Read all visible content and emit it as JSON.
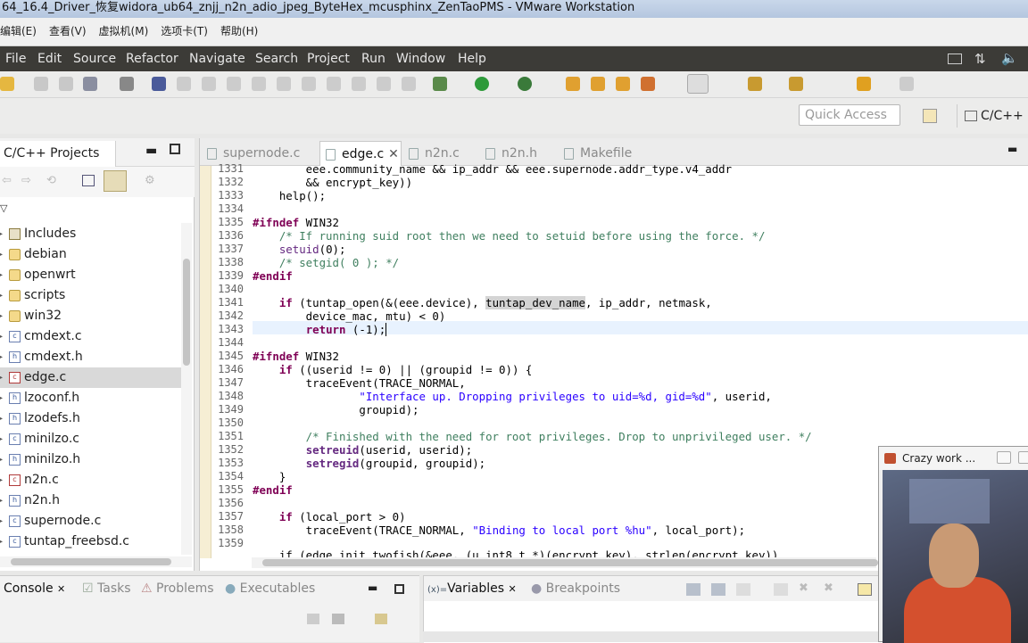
{
  "window": {
    "title": "64_16.4_Driver_恢复widora_ub64_znjj_n2n_adio_jpeg_ByteHex_mcusphinx_ZenTaoPMS - VMware Workstation"
  },
  "vm_menu": [
    "编辑(E)",
    "查看(V)",
    "虚拟机(M)",
    "选项卡(T)",
    "帮助(H)"
  ],
  "menu": [
    "File",
    "Edit",
    "Source",
    "Refactor",
    "Navigate",
    "Search",
    "Project",
    "Run",
    "Window",
    "Help"
  ],
  "quick_access": {
    "placeholder": "Quick Access"
  },
  "perspective": {
    "label": "C/C++"
  },
  "project_explorer": {
    "tab_label": "C/C++ Projects",
    "items": [
      {
        "label": "Includes",
        "icon": "includes-icon"
      },
      {
        "label": "debian",
        "icon": "folder-icon"
      },
      {
        "label": "openwrt",
        "icon": "folder-icon"
      },
      {
        "label": "scripts",
        "icon": "folder-icon"
      },
      {
        "label": "win32",
        "icon": "folder-icon"
      },
      {
        "label": "cmdext.c",
        "icon": "c-file-icon"
      },
      {
        "label": "cmdext.h",
        "icon": "h-file-icon"
      },
      {
        "label": "edge.c",
        "icon": "c-file-error-icon"
      },
      {
        "label": "lzoconf.h",
        "icon": "h-file-icon"
      },
      {
        "label": "lzodefs.h",
        "icon": "h-file-icon"
      },
      {
        "label": "minilzo.c",
        "icon": "c-file-icon"
      },
      {
        "label": "minilzo.h",
        "icon": "h-file-icon"
      },
      {
        "label": "n2n.c",
        "icon": "c-file-error-icon"
      },
      {
        "label": "n2n.h",
        "icon": "h-file-icon"
      },
      {
        "label": "supernode.c",
        "icon": "c-file-icon"
      },
      {
        "label": "tuntap_freebsd.c",
        "icon": "c-file-icon"
      }
    ]
  },
  "editor": {
    "tabs": [
      {
        "label": "supernode.c",
        "active": false
      },
      {
        "label": "edge.c",
        "active": true
      },
      {
        "label": "n2n.c",
        "active": false
      },
      {
        "label": "n2n.h",
        "active": false
      },
      {
        "label": "Makefile",
        "active": false
      }
    ],
    "line_numbers": [
      "1331",
      "1332",
      "1333",
      "1334",
      "1335",
      "1336",
      "1337",
      "1338",
      "1339",
      "1340",
      "1341",
      "1342",
      "1343",
      "1344",
      "1345",
      "1346",
      "1347",
      "1348",
      "1349",
      "1350",
      "1351",
      "1352",
      "1353",
      "1354",
      "1355",
      "1356",
      "1357",
      "1358",
      "1359"
    ],
    "code": {
      "l1331": "        eee.community_name && ip_addr && eee.supernode.addr_type.v4_addr",
      "l1332": "        && encrypt_key))",
      "l1333": "    help();",
      "l1335a": "#ifndef",
      "l1335b": " WIN32",
      "l1336": "    /* If running suid root then we need to setuid before using the force. */",
      "l1337a": "setuid",
      "l1337b": "(0);",
      "l1338": "    /* setgid( 0 ); */",
      "l1339": "#endif",
      "l1341a": "if",
      "l1341b": " (tuntap_open(&(eee.device), ",
      "l1341c": "tuntap_dev_name",
      "l1341d": ", ip_addr, netmask,",
      "l1342": "        device_mac, mtu) < 0)",
      "l1343a": "return",
      "l1343b": " (-1);",
      "l1345a": "#ifndef",
      "l1345b": " WIN32",
      "l1346a": "if",
      "l1346b": " ((userid != 0) || (groupid != 0)) {",
      "l1347": "        traceEvent(TRACE_NORMAL,",
      "l1348a": "\"Interface up. Dropping privileges to uid=%d, gid=%d\"",
      "l1348b": ", userid,",
      "l1349": "                groupid);",
      "l1351": "        /* Finished with the need for root privileges. Drop to unprivileged user. */",
      "l1352a": "setreuid",
      "l1352b": "(userid, userid);",
      "l1353a": "setregid",
      "l1353b": "(groupid, groupid);",
      "l1354": "    }",
      "l1355": "#endif",
      "l1357a": "if",
      "l1357b": " (local_port > 0)",
      "l1358a": "        traceEvent(TRACE_NORMAL, ",
      "l1358b": "\"Binding to local port %hu\"",
      "l1358c": ", local_port);",
      "l1360": "    if (edge_init_twofish(&eee, (u_int8_t *)(encrypt_key), strlen(encrypt_key))"
    }
  },
  "bottom_left": {
    "tabs": [
      "Console",
      "Tasks",
      "Problems",
      "Executables"
    ]
  },
  "bottom_right": {
    "tabs": [
      "Variables",
      "Breakpoints"
    ]
  },
  "video": {
    "title": "Crazy work ..."
  }
}
